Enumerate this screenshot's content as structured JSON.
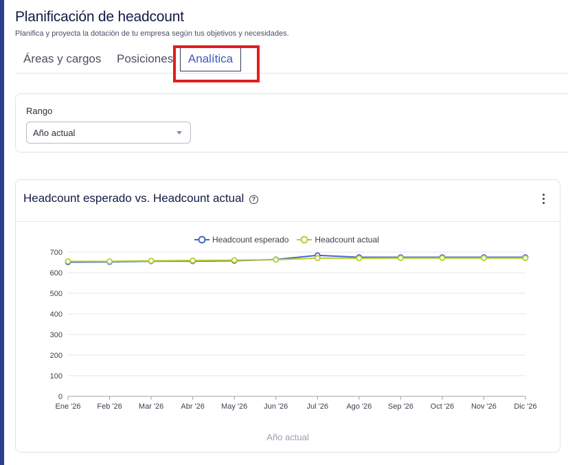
{
  "header": {
    "title": "Planificación de headcount",
    "subtitle": "Planifica y proyecta la dotación de tu empresa según tus objetivos y necesidades."
  },
  "tabs": [
    {
      "label": "Áreas y cargos"
    },
    {
      "label": "Posiciones"
    },
    {
      "label": "Analítica",
      "active": true
    }
  ],
  "range": {
    "label": "Rango",
    "selected": "Año actual"
  },
  "card": {
    "title": "Headcount esperado vs. Headcount actual",
    "help_icon": "question-circle-icon",
    "menu_icon": "kebab-menu-icon"
  },
  "colors": {
    "accent": "#3d58b7",
    "highlight": "#e11d1d",
    "series_expected": "#4466cc",
    "series_actual": "#b5cf2a"
  },
  "chart_data": {
    "type": "line",
    "categories": [
      "Ene '26",
      "Feb '26",
      "Mar '26",
      "Abr '26",
      "May '26",
      "Jun '26",
      "Jul '26",
      "Ago '26",
      "Sep '26",
      "Oct '26",
      "Nov '26",
      "Dic '26"
    ],
    "series": [
      {
        "name": "Headcount esperado",
        "color": "#4466cc",
        "values": [
          651,
          652,
          656,
          656,
          658,
          664,
          684,
          675,
          675,
          675,
          675,
          675
        ]
      },
      {
        "name": "Headcount actual",
        "color": "#b5cf2a",
        "values": [
          655,
          655,
          658,
          659,
          661,
          663,
          671,
          670,
          671,
          671,
          671,
          671
        ]
      }
    ],
    "yticks": [
      0,
      100,
      200,
      300,
      400,
      500,
      600,
      700
    ],
    "ylim": [
      0,
      700
    ],
    "xlabel": "Año actual",
    "legend": "top-center",
    "grid": true
  }
}
